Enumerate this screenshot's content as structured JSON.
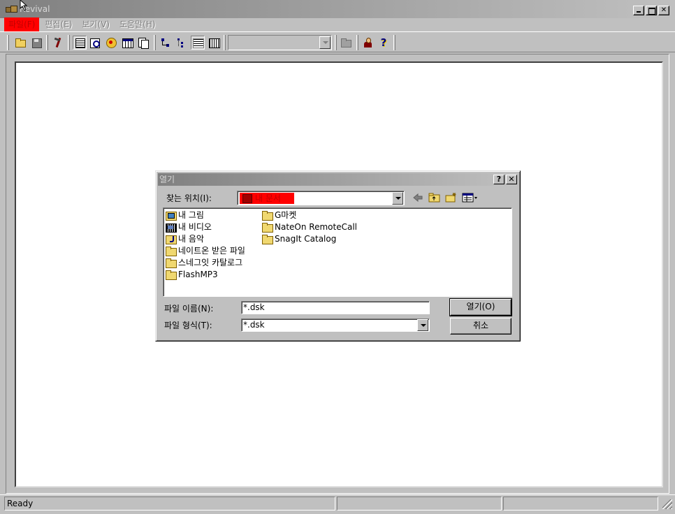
{
  "window": {
    "title": "Revival"
  },
  "menu": [
    {
      "label": "파일(F)",
      "active": true
    },
    {
      "label": "편집(E)",
      "active": false
    },
    {
      "label": "보기(V)",
      "active": false
    },
    {
      "label": "도움말(H)",
      "active": false
    }
  ],
  "toolbar": {
    "buttons": [
      "open-icon",
      "save-icon",
      "tools-icon",
      "list-view-icon",
      "find-icon",
      "disc-icon",
      "table-icon",
      "pages-icon",
      "nodes-icon",
      "tree-icon",
      "details-icon",
      "grid-icon",
      "folder-icon",
      "user-icon",
      "help-icon"
    ],
    "combo_value": ""
  },
  "status": {
    "text": "Ready",
    "pane2": "",
    "pane3": ""
  },
  "dialog": {
    "title": "열기",
    "help_btn": "?",
    "close_btn": "✕",
    "look_in_label": "찾는 위치(I):",
    "look_in_value": "내 문서",
    "files": [
      {
        "name": "내 그림",
        "icon": "pictures-folder-icon"
      },
      {
        "name": "내 비디오",
        "icon": "video-folder-icon"
      },
      {
        "name": "내 음악",
        "icon": "music-folder-icon"
      },
      {
        "name": "네이트온 받은 파일",
        "icon": "folder-icon"
      },
      {
        "name": "스네그잇 카탈로그",
        "icon": "folder-icon"
      },
      {
        "name": "FlashMP3",
        "icon": "folder-icon"
      },
      {
        "name": "G마켓",
        "icon": "folder-icon"
      },
      {
        "name": "NateOn RemoteCall",
        "icon": "folder-icon"
      },
      {
        "name": "SnagIt Catalog",
        "icon": "folder-icon"
      }
    ],
    "filename_label": "파일 이름(N):",
    "filename_value": "*.dsk",
    "filetype_label": "파일 형식(T):",
    "filetype_value": "*.dsk",
    "open_button": "열기(O)",
    "cancel_button": "취소"
  }
}
